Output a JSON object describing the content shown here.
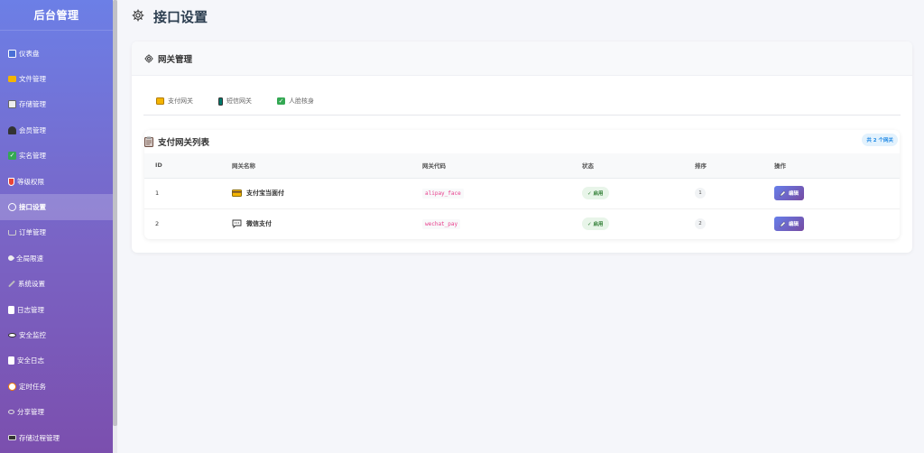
{
  "sidebar": {
    "title": "后台管理",
    "items": [
      {
        "label": "仪表盘",
        "icon": "chart-icon",
        "color": "#4a6fd6",
        "active": false
      },
      {
        "label": "文件管理",
        "icon": "folder-icon",
        "color": "#f4b400",
        "active": false
      },
      {
        "label": "存储管理",
        "icon": "storage-icon",
        "color": "#eeeeee",
        "active": false
      },
      {
        "label": "会员管理",
        "icon": "users-icon",
        "color": "#333333",
        "active": false
      },
      {
        "label": "实名管理",
        "icon": "check-icon",
        "color": "#34a853",
        "active": false
      },
      {
        "label": "等级权限",
        "icon": "shield-icon",
        "color": "#ea4335",
        "active": false
      },
      {
        "label": "接口设置",
        "icon": "gear-icon",
        "color": "#ffffff",
        "active": true
      },
      {
        "label": "订单管理",
        "icon": "cart-icon",
        "color": "#9aa0a6",
        "active": false
      },
      {
        "label": "全局限速",
        "icon": "rocket-icon",
        "color": "#eeeeee",
        "active": false
      },
      {
        "label": "系统设置",
        "icon": "wrench-icon",
        "color": "#bdbdbd",
        "active": false
      },
      {
        "label": "日志管理",
        "icon": "document-icon",
        "color": "#ffffff",
        "active": false
      },
      {
        "label": "安全监控",
        "icon": "eye-icon",
        "color": "#ffffff",
        "active": false
      },
      {
        "label": "安全日志",
        "icon": "document-icon",
        "color": "#ffffff",
        "active": false
      },
      {
        "label": "定时任务",
        "icon": "alarm-icon",
        "color": "#f57c00",
        "active": false
      },
      {
        "label": "分享管理",
        "icon": "link-icon",
        "color": "#dddddd",
        "active": false
      },
      {
        "label": "存储过程管理",
        "icon": "computer-icon",
        "color": "#333333",
        "active": false
      }
    ]
  },
  "header": {
    "title": "接口设置"
  },
  "gateway_card": {
    "title": "网关管理",
    "tabs": [
      {
        "label": "支付网关",
        "icon": "card-icon",
        "color": "#f4b400"
      },
      {
        "label": "短信网关",
        "icon": "phone-icon",
        "color": "#00796b"
      },
      {
        "label": "人脸核身",
        "icon": "check-icon",
        "color": "#34a853"
      }
    ]
  },
  "payment_list": {
    "title": "支付网关列表",
    "count_badge": "共 2 个网关",
    "columns": [
      "ID",
      "网关名称",
      "网关代码",
      "状态",
      "排序",
      "操作"
    ],
    "rows": [
      {
        "id": "1",
        "name": "支付宝当面付",
        "icon": "card-icon",
        "code": "alipay_face",
        "status": "✓ 启用",
        "sort": "1",
        "action": "编辑"
      },
      {
        "id": "2",
        "name": "微信支付",
        "icon": "chat-icon",
        "code": "wechat_pay",
        "status": "✓ 启用",
        "sort": "2",
        "action": "编辑"
      }
    ]
  }
}
